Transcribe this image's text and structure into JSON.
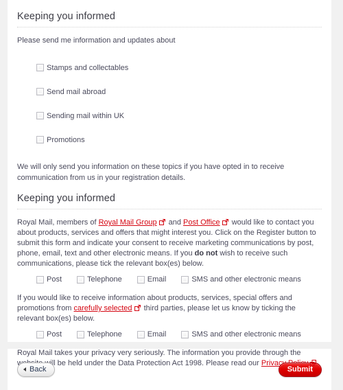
{
  "theme": {
    "page_background": "#f1f1f1",
    "panel_background": "#ffffff",
    "link_color": "#d40511",
    "submit_color": "#e00000",
    "text_color": "#4a4a5c",
    "heading_color": "#3d3d46"
  },
  "section1": {
    "title": "Keeping you informed",
    "intro": "Please send me information and updates about",
    "checkboxes": [
      {
        "label": "Stamps and collectables",
        "checked": false
      },
      {
        "label": "Send mail abroad",
        "checked": false
      },
      {
        "label": "Sending mail within UK",
        "checked": false
      },
      {
        "label": "Promotions",
        "checked": false
      }
    ],
    "note": "We will only send you information on these topics if you have opted in to receive communication from us in your registration details."
  },
  "section2": {
    "title": "Keeping you informed",
    "paragraph": {
      "part1": "Royal Mail, members of ",
      "link1": "Royal Mail Group",
      "part2": " and ",
      "link2": "Post Office",
      "part3": " would like to contact you about products, services and offers that might interest you. Click on the Register button to submit this form and indicate your consent to receive marketing communications by post, phone, email, text and other electronic means. If you ",
      "strong": "do not",
      "part4": " wish to receive such communications, please tick the relevant box(es) below."
    },
    "consent_checkboxes": [
      {
        "label": "Post",
        "checked": false
      },
      {
        "label": "Telephone",
        "checked": false
      },
      {
        "label": "Email",
        "checked": false
      },
      {
        "label": "SMS and other electronic means",
        "checked": false
      }
    ],
    "third_party": {
      "part1": "If you would like to receive information about products, services, special offers and promotions from ",
      "link1": "carefully selected",
      "part2": " third parties, please let us know by ticking the relevant box(es) below."
    },
    "third_party_checkboxes": [
      {
        "label": "Post",
        "checked": false
      },
      {
        "label": "Telephone",
        "checked": false
      },
      {
        "label": "Email",
        "checked": false
      },
      {
        "label": "SMS and other electronic means",
        "checked": false
      }
    ],
    "privacy": {
      "part1": "Royal Mail takes your privacy very seriously. The information you provide through the website will be held under the Data Protection Act 1998. Please read our ",
      "link1": "Privacy Policy"
    }
  },
  "footer": {
    "back_label": "Back",
    "submit_label": "Submit"
  },
  "icons": {
    "external_link": "external-link-icon",
    "back_arrow": "arrow-left-icon"
  }
}
